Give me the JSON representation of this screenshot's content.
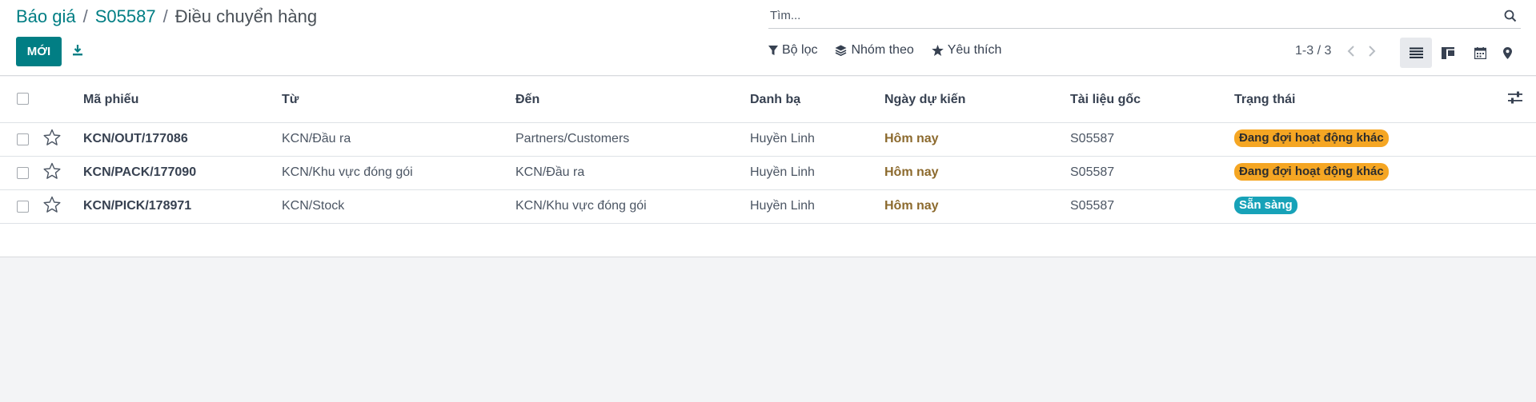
{
  "breadcrumb": {
    "items": [
      "Báo giá",
      "S05587"
    ],
    "separator": "/",
    "current": "Điều chuyển hàng"
  },
  "toolbar": {
    "new_label": "MỚI",
    "download_icon": "download-icon"
  },
  "search": {
    "placeholder": "Tìm...",
    "value": ""
  },
  "filters": {
    "filter_label": "Bộ lọc",
    "group_label": "Nhóm theo",
    "favorite_label": "Yêu thích"
  },
  "pager": {
    "text": "1-3 / 3"
  },
  "views": [
    "list-view-icon",
    "kanban-view-icon",
    "calendar-view-icon",
    "map-view-icon"
  ],
  "table": {
    "columns": [
      "Mã phiếu",
      "Từ",
      "Đến",
      "Danh bạ",
      "Ngày dự kiến",
      "Tài liệu gốc",
      "Trạng thái"
    ],
    "rows": [
      {
        "ref": "KCN/OUT/177086",
        "from": "KCN/Đầu ra",
        "to": "Partners/Customers",
        "contact": "Huyền Linh",
        "scheduled": "Hôm nay",
        "origin": "S05587",
        "status": "Đang đợi hoạt động khác",
        "status_color": "#f5a623"
      },
      {
        "ref": "KCN/PACK/177090",
        "from": "KCN/Khu vực đóng gói",
        "to": "KCN/Đầu ra",
        "contact": "Huyền Linh",
        "scheduled": "Hôm nay",
        "origin": "S05587",
        "status": "Đang đợi hoạt động khác",
        "status_color": "#f5a623"
      },
      {
        "ref": "KCN/PICK/178971",
        "from": "KCN/Stock",
        "to": "KCN/Khu vực đóng gói",
        "contact": "Huyền Linh",
        "scheduled": "Hôm nay",
        "origin": "S05587",
        "status": "Sẵn sàng",
        "status_color": "#17a2b8"
      }
    ]
  },
  "colors": {
    "accent": "#017e84",
    "date_text": "#8c6a2e",
    "waiting_badge": "#f5a623",
    "ready_badge": "#17a2b8"
  }
}
